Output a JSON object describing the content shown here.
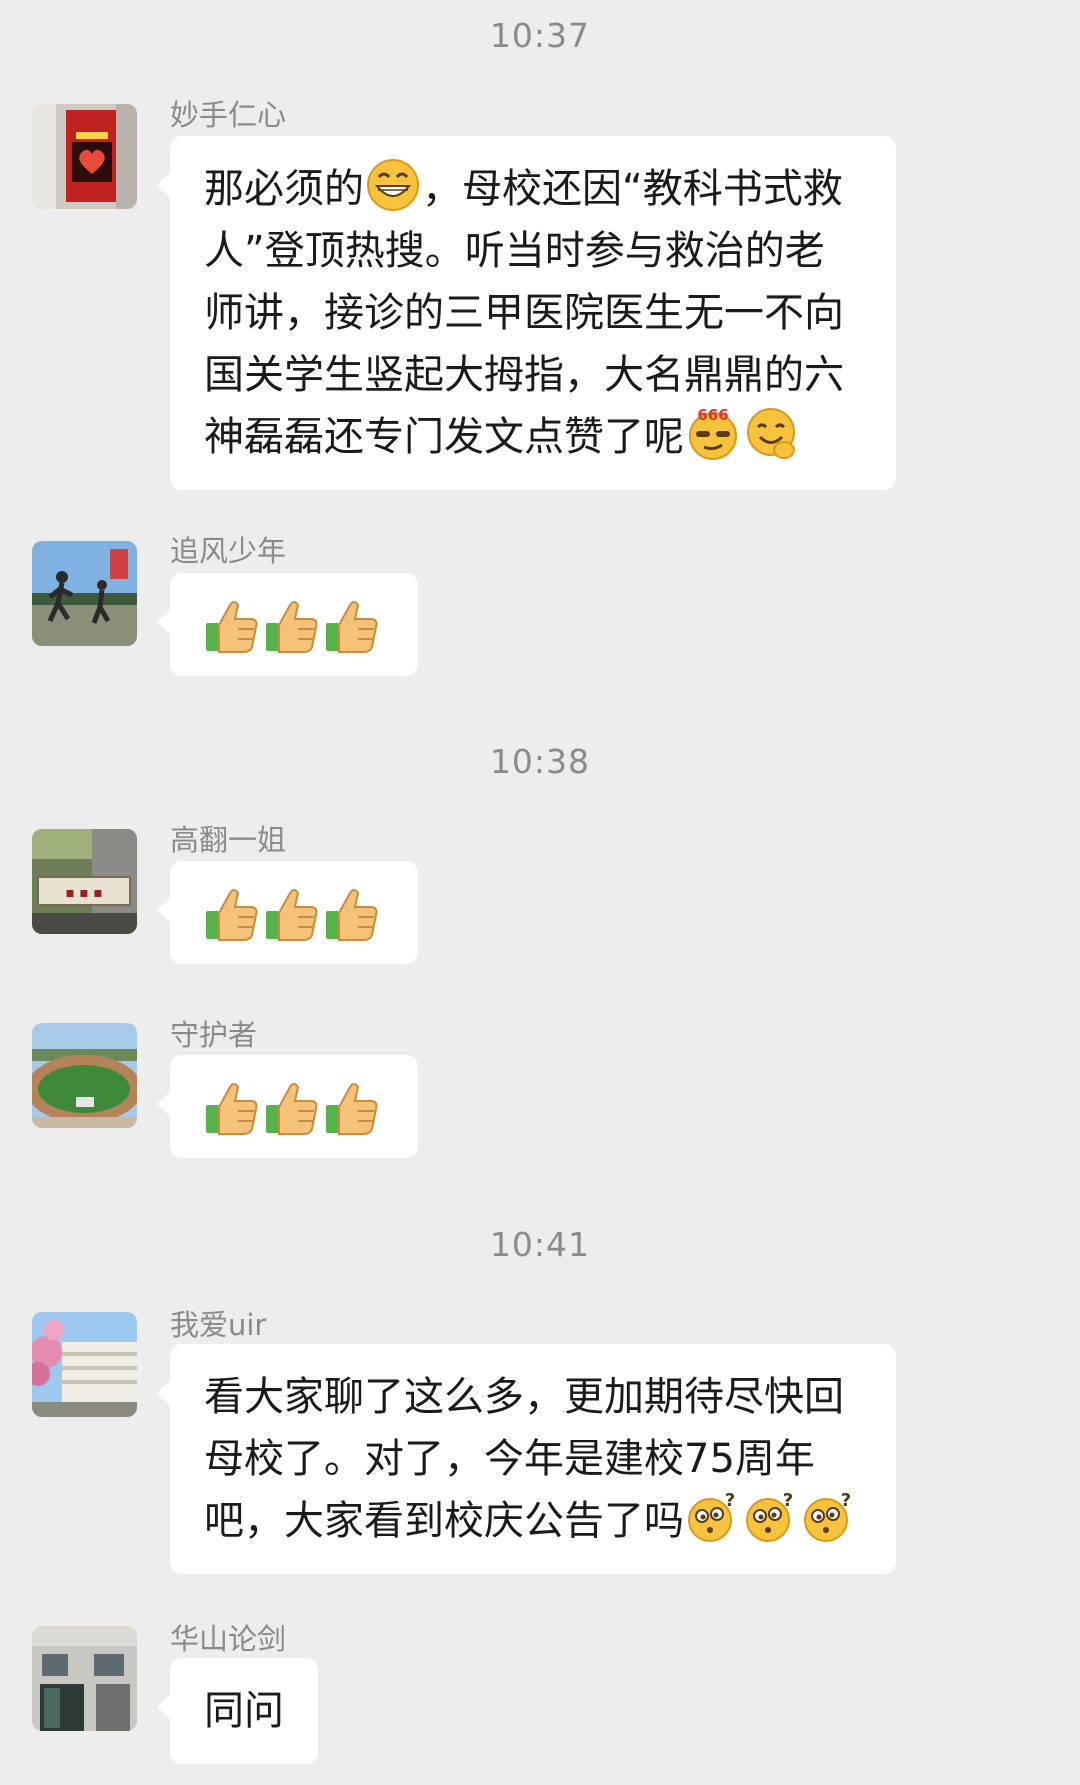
{
  "timestamps": [
    "10:37",
    "10:38",
    "10:41"
  ],
  "messages": [
    {
      "sender": "妙手仁心",
      "avatar": "aed-box-avatar",
      "parts": [
        "那必须的",
        "，母校还因“教科书式救人”登顶热搜。听当时参与救治的老师讲，接诊的三甲医院医生无一不向国关学生竖起大拇指，大名鼎鼎的六神磊磊还专门发文点赞了呢"
      ],
      "emojis": [
        "grin-emoji",
        "666-emoji",
        "peace-emoji"
      ]
    },
    {
      "sender": "追风少年",
      "avatar": "runners-avatar",
      "emojis": [
        "thumbs-up-icon",
        "thumbs-up-icon",
        "thumbs-up-icon"
      ]
    },
    {
      "sender": "高翻一姐",
      "avatar": "library-sign-avatar",
      "emojis": [
        "thumbs-up-icon",
        "thumbs-up-icon",
        "thumbs-up-icon"
      ]
    },
    {
      "sender": "守护者",
      "avatar": "sports-field-avatar",
      "emojis": [
        "thumbs-up-icon",
        "thumbs-up-icon",
        "thumbs-up-icon"
      ]
    },
    {
      "sender": "我爱uir",
      "avatar": "campus-building-avatar",
      "text": "看大家聊了这么多，更加期待尽快回母校了。对了，今年是建校75周年吧，大家看到校庆公告了吗",
      "emojis": [
        "question-emoji",
        "question-emoji",
        "question-emoji"
      ]
    },
    {
      "sender": "华山论剑",
      "avatar": "building-door-avatar",
      "text": "同问"
    }
  ],
  "colors": {
    "background": "#ededed",
    "bubble": "#ffffff",
    "meta_text": "#8a8a8a",
    "emoji_yellow": "#f7c23c",
    "thumb_skin": "#f5c27a",
    "thumb_cuff": "#55b34a"
  }
}
